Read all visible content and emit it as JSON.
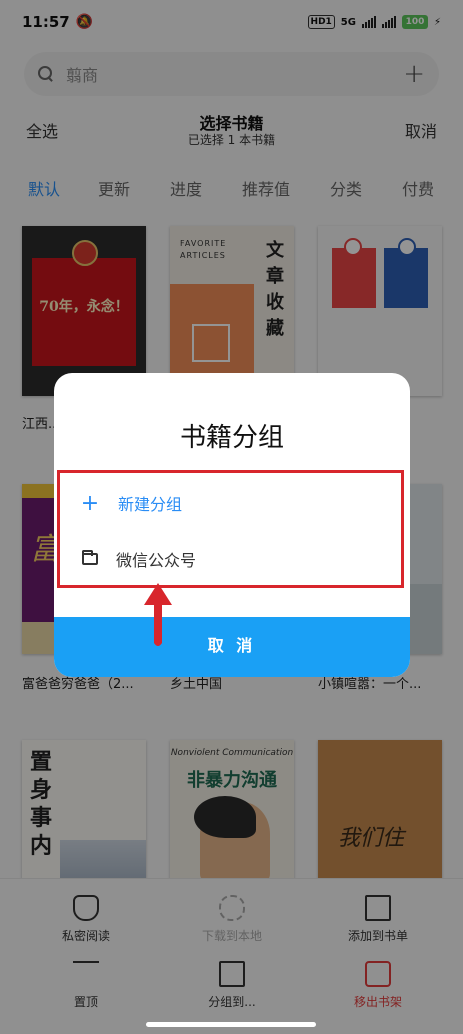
{
  "status_bar": {
    "time": "11:57",
    "network": "5G",
    "battery": "100"
  },
  "search": {
    "placeholder": "翦商"
  },
  "selection": {
    "select_all": "全选",
    "title": "选择书籍",
    "subtitle": "已选择 1 本书籍",
    "cancel": "取消"
  },
  "sort_tabs": [
    {
      "label": "默认",
      "active": true
    },
    {
      "label": "更新",
      "active": false
    },
    {
      "label": "进度",
      "active": false
    },
    {
      "label": "推荐值",
      "active": false
    },
    {
      "label": "分类",
      "active": false
    },
    {
      "label": "付费",
      "active": false
    }
  ],
  "books": [
    {
      "title": "江西..."
    },
    {
      "title": ""
    },
    {
      "title": ""
    },
    {
      "title": "富爸爸穷爸爸（2..."
    },
    {
      "title": "乡土中国"
    },
    {
      "title": "小镇喧嚣：一个..."
    },
    {
      "title": ""
    },
    {
      "title": ""
    },
    {
      "title": ""
    }
  ],
  "cover_text": {
    "book1_slogan": "70年，永念！",
    "book2_fav": "FAVORITE\nARTICLES",
    "book2_title": "文章收藏",
    "book7_title": "置身事内",
    "book8_subtitle": "Nonviolent Communication",
    "book8_title": "非暴力沟通",
    "book9_text": "我们住"
  },
  "bottom_actions": [
    {
      "label": "私密阅读",
      "icon": "mask-icon"
    },
    {
      "label": "下载到本地",
      "icon": "download-icon"
    },
    {
      "label": "添加到书单",
      "icon": "list-icon"
    },
    {
      "label": "置顶",
      "icon": "pin-top-icon"
    },
    {
      "label": "分组到...",
      "icon": "folder-move-icon"
    },
    {
      "label": "移出书架",
      "icon": "remove-shelf-icon"
    }
  ],
  "dialog": {
    "title": "书籍分组",
    "new_group": "新建分组",
    "groups": [
      "微信公众号"
    ],
    "cancel": "取 消"
  },
  "colors": {
    "accent": "#2a8df5",
    "cancel_button": "#1aa0f5",
    "highlight": "#d8262c",
    "danger": "#e23c3c"
  }
}
